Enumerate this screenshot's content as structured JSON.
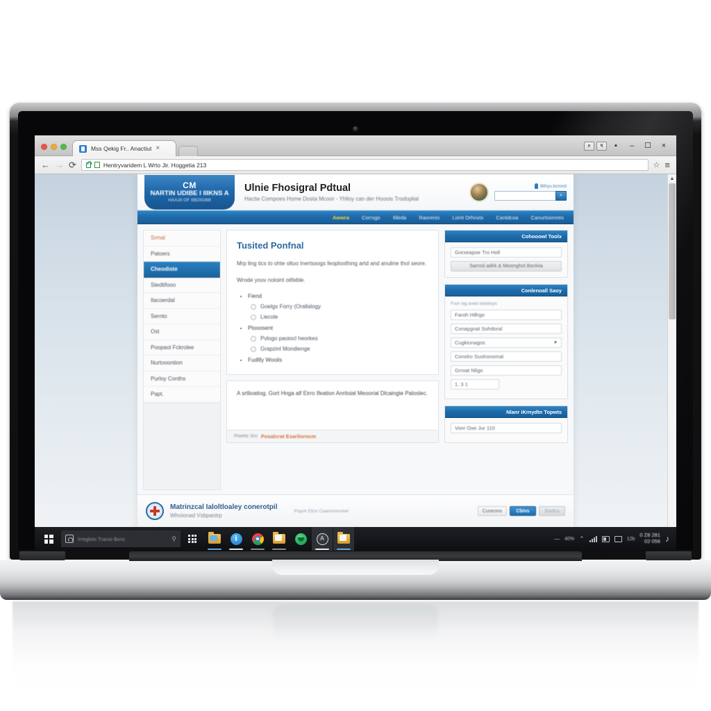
{
  "browser": {
    "tab": {
      "title": "Mss Qekig Fr.. Anactiut",
      "close_label": "×",
      "favicon": "page-favicon"
    },
    "newtab_label": "",
    "extensions": [
      {
        "name": "extension-button-1",
        "glyph": "e"
      },
      {
        "name": "extension-button-2",
        "glyph": "ष"
      }
    ],
    "window_controls": {
      "restore": "▪",
      "minimize": "–",
      "maximize": "☐",
      "close": "×"
    },
    "toolbar": {
      "back": "←",
      "forward": "→",
      "reload": "⟳",
      "url": "Hentryvaridem L Wrto Jir. Hoggetia 213",
      "url_placeholder": "Search or type a URL",
      "bookmark": "☆",
      "menu": "≡"
    }
  },
  "site": {
    "brand": {
      "mark": "CM",
      "name": "NARTIN UDIBE I IIIKNS A",
      "sub": "HAAJII OF IIBOIGIMI"
    },
    "title": "Ulnie Fhosigral Pdtual",
    "tagline": "Hactw Compoes Hsme Dosta Mcoor - Yhlloy can der Hooois Trodoplial",
    "login_text": "Bifryu.bcmnd",
    "search": {
      "value": "",
      "placeholder": "",
      "button": "⌕"
    },
    "nav": [
      {
        "label": "Awwra",
        "active": true
      },
      {
        "label": "Corrsgo",
        "active": false
      },
      {
        "label": "Ilileda",
        "active": false
      },
      {
        "label": "Raorenis",
        "active": false
      },
      {
        "label": "Lomt Orhnxtx",
        "active": false
      },
      {
        "label": "Cantdcoa",
        "active": false
      },
      {
        "label": "Canurtoomres",
        "active": false
      }
    ]
  },
  "sidebar": {
    "items": [
      {
        "label": "Srmal",
        "style": "heading"
      },
      {
        "label": "Patoers",
        "style": "normal"
      },
      {
        "label": "Cheodiste",
        "style": "active"
      },
      {
        "label": "Stedtifooo",
        "style": "normal"
      },
      {
        "label": "Ilacoerdal",
        "style": "normal"
      },
      {
        "label": "Sernto",
        "style": "normal"
      },
      {
        "label": "Ost",
        "style": "normal"
      },
      {
        "label": "Poopaol Fckrolee",
        "style": "normal"
      },
      {
        "label": "Nurtooontion",
        "style": "normal"
      },
      {
        "label": "Purloy Conths",
        "style": "normal"
      },
      {
        "label": "Papt.",
        "style": "normal"
      }
    ]
  },
  "main": {
    "title": "Tusited Ponfnal",
    "paragraph1": "Mrp ling tics to ohte oltuo Inertssogs feoploothing artd and anuline thol seore.",
    "paragraph2": "Wrode youv noloint oitfeble.",
    "options": [
      {
        "label": "Fiend",
        "radios": [
          "Goelgx Forry (Orallalogy",
          "Liecole"
        ]
      },
      {
        "label": "Ptooosent",
        "radios": [
          "Pvlogo paoiocl heorkes",
          "Grapzinl Mondienge"
        ]
      },
      {
        "label": "Fudllly Wooils",
        "radios": []
      }
    ],
    "notice": "A srtlioatiog, Gort Hnga alf Eirro Ifeation Anritoial Meoorial Dlcaingte Paloslec.",
    "notice_footer_label": "Piwete Sro",
    "notice_footer_link": "Posalcrat Esarliorocm"
  },
  "right_panels": [
    {
      "title": "Cohooowl Toolx",
      "note": "",
      "fields": [
        {
          "value": "Gorxeapoe Tro Holl",
          "type": "text"
        }
      ],
      "button": "Sarrosl adirk & Mioonghot Bonlvia"
    },
    {
      "title": "Conlenoall Saoy",
      "note": "Foor sig ased sidoboys",
      "fields": [
        {
          "value": "Faroh Hillrgo",
          "type": "text"
        },
        {
          "value": "Conaygnat Sohdoral",
          "type": "text"
        },
        {
          "value": "Cugkiunagos",
          "type": "select",
          "caret": "▼"
        },
        {
          "value": "Conxlro Suohonomal",
          "type": "text"
        },
        {
          "value": "Grroat Nligo",
          "type": "text"
        },
        {
          "value": "1. 3 1",
          "type": "small"
        }
      ],
      "button": ""
    },
    {
      "title": "Nlanr iKrnydtn Topwts",
      "note": "",
      "fields": [
        {
          "value": "Vonr Oxe Jur 110",
          "type": "text"
        }
      ],
      "button": ""
    }
  ],
  "footer": {
    "logo": "medical-cross-logo",
    "title": "Matrinzcal Ialoltloaley conerotpil",
    "subtitle": "Whoionad Vsbpaotrp",
    "middle_text": "Popsh Etror Caanmomohel",
    "buttons": [
      {
        "label": "Cuneono",
        "style": "plain"
      },
      {
        "label": "Cbivs",
        "style": "primary"
      },
      {
        "label": "Sovtcu",
        "style": "ghost"
      }
    ]
  },
  "page_scrollbar": {
    "up": "▲",
    "down": "▼"
  },
  "taskbar": {
    "start": "start-button",
    "search": {
      "placeholder": "Irregloio Transi-$onc",
      "mic": "⚲"
    },
    "task_view": "task-view-button",
    "apps": [
      {
        "name": "taskbar-folder-blue",
        "icon": "folder-blue-icon",
        "state": "open"
      },
      {
        "name": "taskbar-info",
        "icon": "info-icon",
        "state": "openw"
      },
      {
        "name": "taskbar-chrome",
        "icon": "chrome-icon",
        "state": "openg"
      },
      {
        "name": "taskbar-folder-white",
        "icon": "folder-white-icon",
        "state": "openg"
      },
      {
        "name": "taskbar-green-app",
        "icon": "green-circle-icon",
        "state": "none"
      },
      {
        "name": "taskbar-compass",
        "icon": "compass-icon",
        "state": "openw",
        "active": true
      },
      {
        "name": "taskbar-photos",
        "icon": "photos-folder-icon",
        "state": "open",
        "active": true
      }
    ],
    "tray": {
      "pen": "―",
      "pct": "40%",
      "chevron": "⌃",
      "pct2": "12b",
      "clock_line1": "0 Z8 281",
      "clock_line2": "02ּ 056",
      "note": "♪"
    }
  }
}
